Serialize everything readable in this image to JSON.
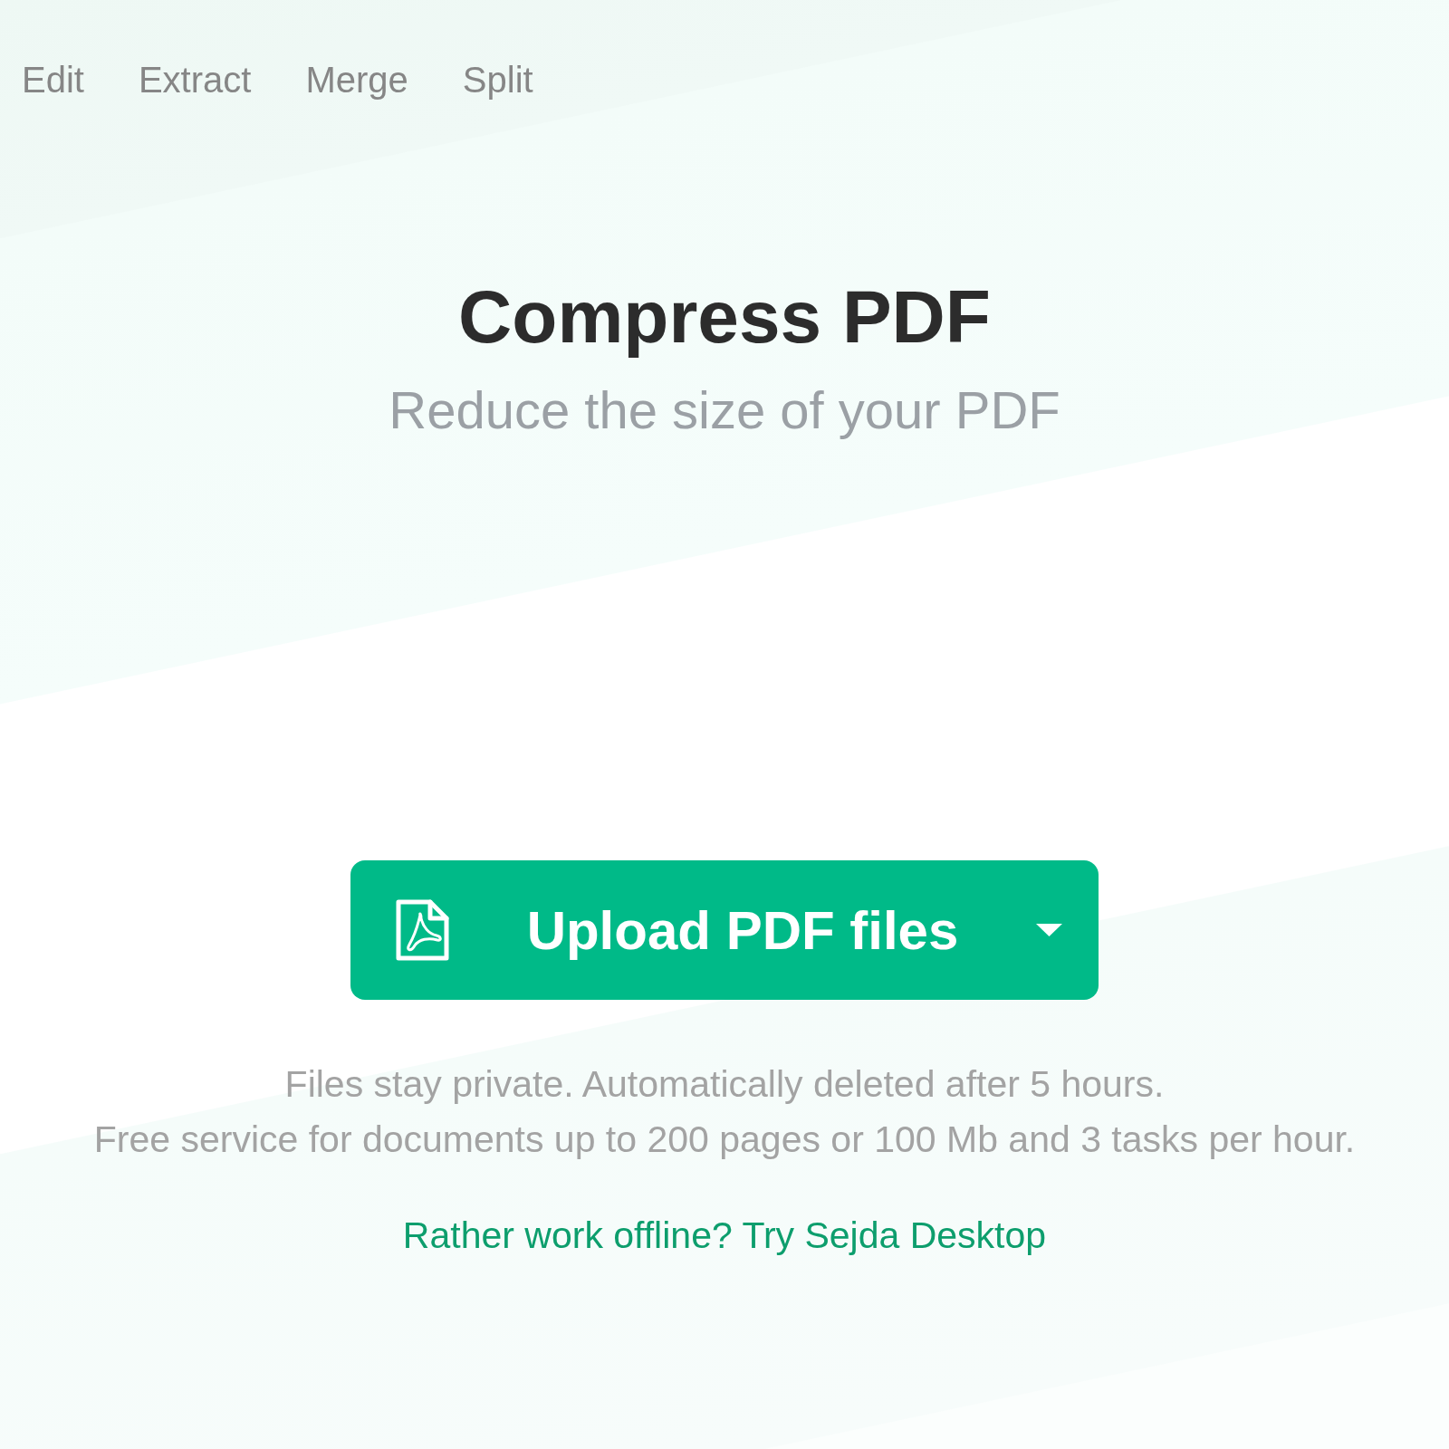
{
  "nav": [
    "Edit",
    "Extract",
    "Merge",
    "Split"
  ],
  "title": "Compress PDF",
  "subtitle": "Reduce the size of your PDF",
  "upload_button": {
    "label": "Upload PDF files"
  },
  "notes": [
    "Files stay private. Automatically deleted after 5 hours.",
    "Free service for documents up to 200 pages or 100 Mb and 3 tasks per hour."
  ],
  "desktop_link": "Rather work offline? Try Sejda Desktop"
}
